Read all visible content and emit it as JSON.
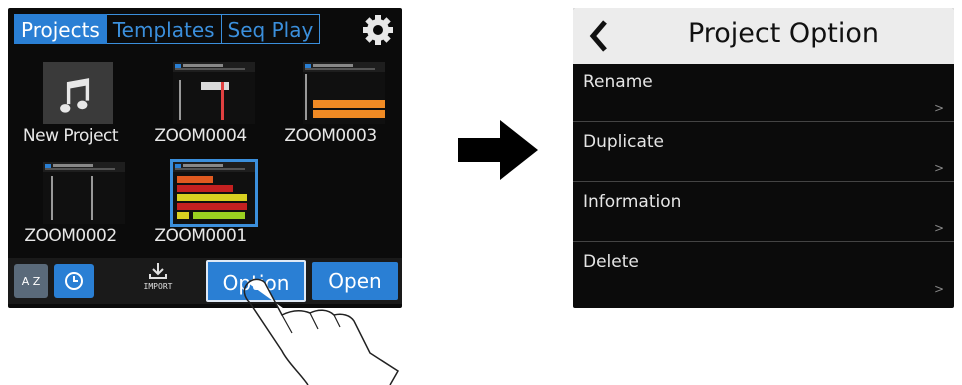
{
  "left_screen": {
    "tabs": [
      {
        "label": "Projects",
        "active": true
      },
      {
        "label": "Templates",
        "active": false
      },
      {
        "label": "Seq Play",
        "active": false
      }
    ],
    "settings_icon": "gear-icon",
    "projects": [
      {
        "name": "New Project",
        "icon": "music-note-icon"
      },
      {
        "name": "ZOOM0004"
      },
      {
        "name": "ZOOM0003"
      },
      {
        "name": "ZOOM0002"
      },
      {
        "name": "ZOOM0001",
        "selected": true
      }
    ],
    "bottom_bar": {
      "sort_alpha_label": "A Z",
      "sort_time_icon": "clock-icon",
      "import_label": "IMPORT",
      "option_label": "Option",
      "open_label": "Open"
    }
  },
  "arrow_icon": "right-arrow-icon",
  "right_screen": {
    "title": "Project Option",
    "back_icon": "chevron-left-icon",
    "items": [
      {
        "label": "Rename"
      },
      {
        "label": "Duplicate"
      },
      {
        "label": "Information"
      },
      {
        "label": "Delete"
      }
    ],
    "chevron": ">"
  },
  "colors": {
    "accent": "#2a7fd4",
    "screen_bg": "#0b0b0b",
    "header_bg": "#ececec"
  }
}
